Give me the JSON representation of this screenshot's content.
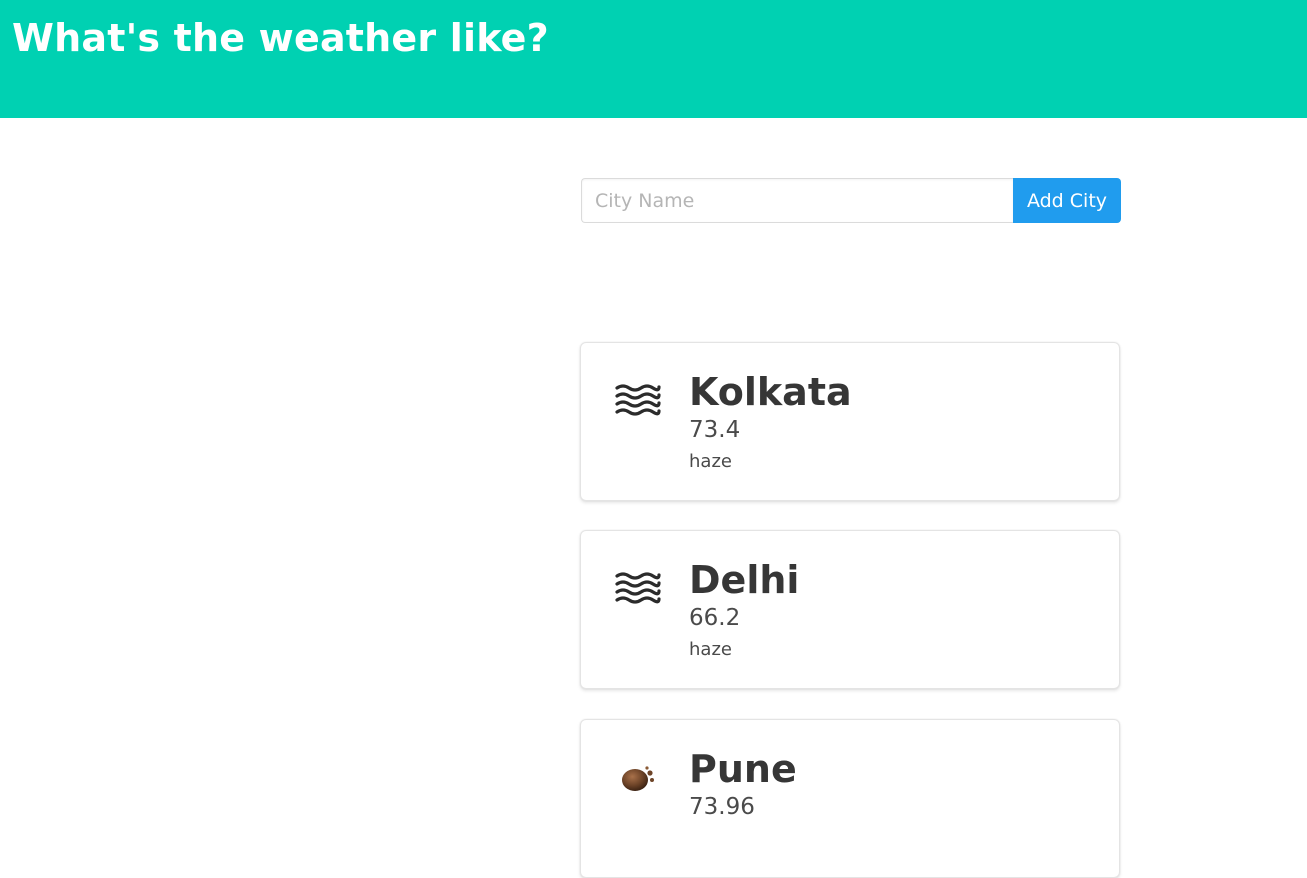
{
  "header": {
    "title": "What's the weather like?",
    "background_color": "#00d1b2"
  },
  "search": {
    "placeholder": "City Name",
    "value": "",
    "button_label": "Add City",
    "button_color": "#209cee"
  },
  "cities": [
    {
      "name": "Kolkata",
      "temperature": "73.4",
      "description": "haze",
      "icon": "haze-icon"
    },
    {
      "name": "Delhi",
      "temperature": "66.2",
      "description": "haze",
      "icon": "haze-icon"
    },
    {
      "name": "Pune",
      "temperature": "73.96",
      "description": "",
      "icon": "smoke-icon"
    }
  ]
}
